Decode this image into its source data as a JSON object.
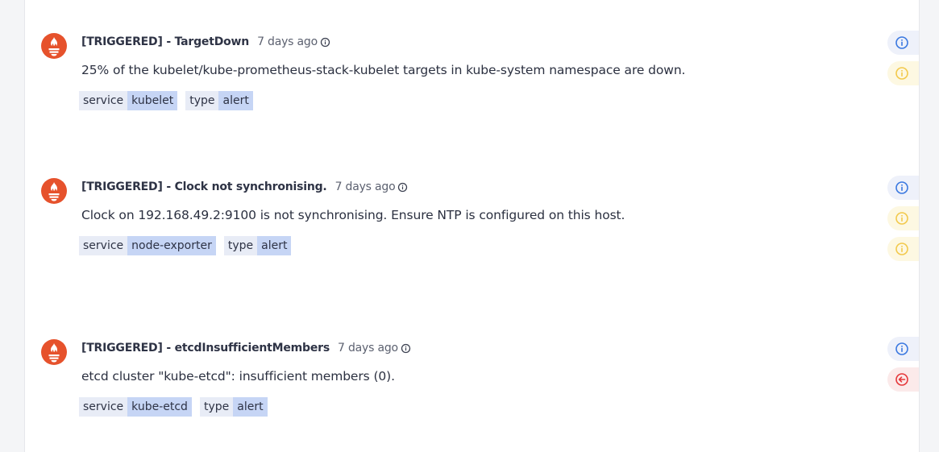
{
  "colors": {
    "brand": "#e6522c",
    "info": "#3a78e0",
    "warning": "#f2c94c",
    "danger": "#e5383b"
  },
  "alerts": [
    {
      "title": "[TRIGGERED] - TargetDown",
      "time": "7 days ago",
      "description": "25% of the kubelet/kube-prometheus-stack-kubelet targets in kube-system namespace are down.",
      "tags": [
        {
          "key": "service",
          "value": "kubelet"
        },
        {
          "key": "type",
          "value": "alert"
        }
      ],
      "actions": [
        "info-icon",
        "warning-icon"
      ]
    },
    {
      "title": "[TRIGGERED] - Clock not synchronising.",
      "time": "7 days ago",
      "description": "Clock on 192.168.49.2:9100 is not synchronising. Ensure NTP is configured on this host.",
      "tags": [
        {
          "key": "service",
          "value": "node-exporter"
        },
        {
          "key": "type",
          "value": "alert"
        }
      ],
      "actions": [
        "info-icon",
        "warning-icon",
        "warning-icon"
      ]
    },
    {
      "title": "[TRIGGERED] - etcdInsufficientMembers",
      "time": "7 days ago",
      "description": "etcd cluster \"kube-etcd\": insufficient members (0).",
      "tags": [
        {
          "key": "service",
          "value": "kube-etcd"
        },
        {
          "key": "type",
          "value": "alert"
        }
      ],
      "actions": [
        "info-icon",
        "arrow-left-circle-icon"
      ]
    }
  ]
}
